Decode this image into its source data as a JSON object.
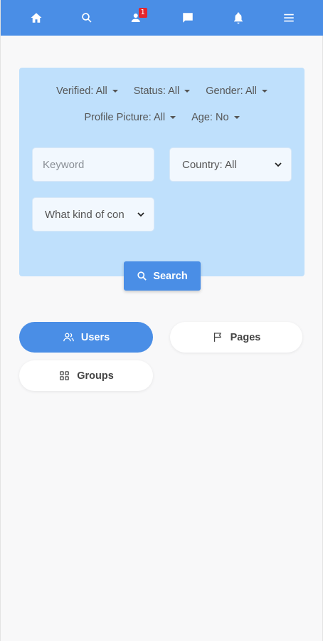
{
  "nav": {
    "items": [
      {
        "icon": "home-icon"
      },
      {
        "icon": "search-icon"
      },
      {
        "icon": "friend-requests-icon",
        "badge": "1"
      },
      {
        "icon": "chat-icon"
      },
      {
        "icon": "bell-icon"
      },
      {
        "icon": "menu-icon"
      }
    ]
  },
  "filters": {
    "verified": "Verified: All",
    "status": "Status: All",
    "gender": "Gender: All",
    "profile_picture": "Profile Picture: All",
    "age": "Age: No"
  },
  "search": {
    "keyword_placeholder": "Keyword",
    "country": "Country: All",
    "kind": "What kind of con",
    "button_label": "Search"
  },
  "tabs": {
    "users": "Users",
    "pages": "Pages",
    "groups": "Groups"
  },
  "colors": {
    "primary": "#4a8ee6",
    "panel": "#bfe0fc",
    "badge": "#e3262e"
  }
}
